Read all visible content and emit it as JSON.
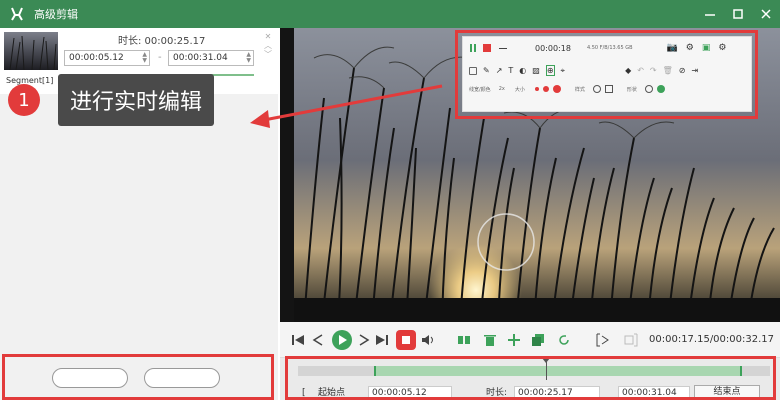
{
  "window": {
    "title": "高级剪辑"
  },
  "clip": {
    "duration_label": "时长: 00:00:25.17",
    "start": "00:00:05.12",
    "end": "00:00:31.04",
    "separator": "-",
    "segment_label": "Segment[1]"
  },
  "callout": {
    "number": "1",
    "text": "进行实时编辑"
  },
  "recorder": {
    "time": "00:00:18",
    "storage": "4.50 F/B/13.65 GB",
    "brush_label": "线宽/颜色",
    "width_value": "2x",
    "size_label": "大小",
    "style_label": "样式",
    "shape_label": "形状"
  },
  "player": {
    "time_readout": "00:00:17.15/00:00:32.17"
  },
  "timeline": {
    "start_button": "起始点",
    "start_value": "00:00:05.12",
    "duration_label": "时长:",
    "duration_value": "00:00:25.17",
    "end_value": "00:00:31.04",
    "end_button": "结束点"
  },
  "colors": {
    "titlebar": "#3b8a55",
    "accent": "#3da25a",
    "highlight_red": "#e23b3b"
  }
}
